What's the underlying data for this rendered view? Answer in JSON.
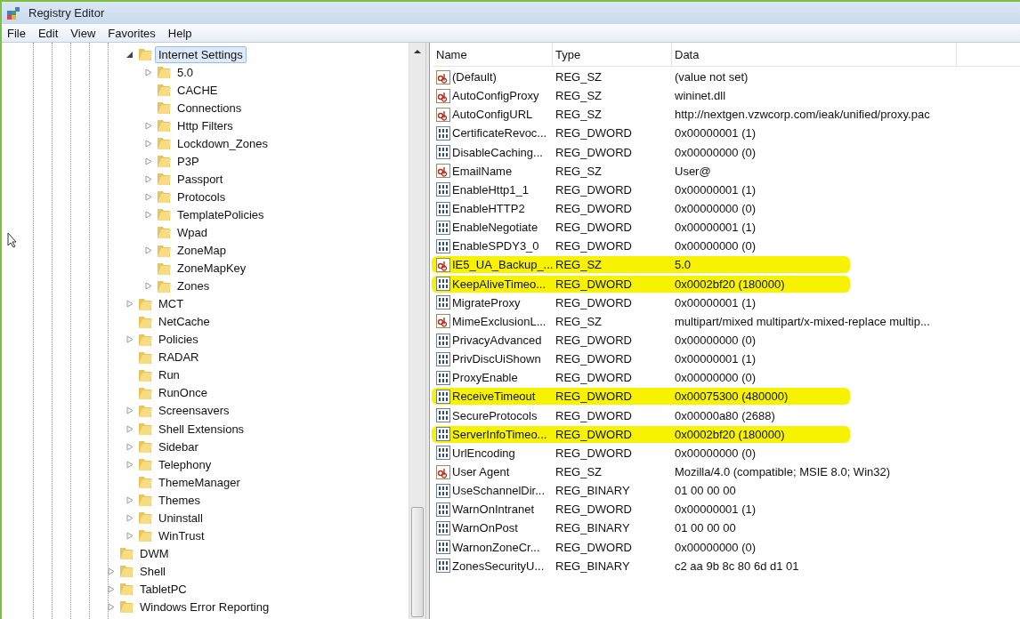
{
  "window": {
    "title": "Registry Editor"
  },
  "menu": [
    "File",
    "Edit",
    "View",
    "Favorites",
    "Help"
  ],
  "tree": {
    "inner_items": [
      {
        "label": "Internet Settings",
        "expandable": true,
        "expanded": true,
        "selected": true,
        "children": [
          {
            "label": "5.0",
            "expandable": true
          },
          {
            "label": "CACHE",
            "expandable": false
          },
          {
            "label": "Connections",
            "expandable": false
          },
          {
            "label": "Http Filters",
            "expandable": true
          },
          {
            "label": "Lockdown_Zones",
            "expandable": true
          },
          {
            "label": "P3P",
            "expandable": true
          },
          {
            "label": "Passport",
            "expandable": true
          },
          {
            "label": "Protocols",
            "expandable": true
          },
          {
            "label": "TemplatePolicies",
            "expandable": true
          },
          {
            "label": "Wpad",
            "expandable": false
          },
          {
            "label": "ZoneMap",
            "expandable": true
          },
          {
            "label": "ZoneMapKey",
            "expandable": false
          },
          {
            "label": "Zones",
            "expandable": true
          }
        ]
      },
      {
        "label": "MCT",
        "expandable": true,
        "expanded": false,
        "selected": false
      },
      {
        "label": "NetCache",
        "expandable": false,
        "selected": false
      },
      {
        "label": "Policies",
        "expandable": true,
        "expanded": false,
        "selected": false
      },
      {
        "label": "RADAR",
        "expandable": false,
        "selected": false
      },
      {
        "label": "Run",
        "expandable": false,
        "selected": false
      },
      {
        "label": "RunOnce",
        "expandable": false,
        "selected": false
      },
      {
        "label": "Screensavers",
        "expandable": true,
        "expanded": false,
        "selected": false
      },
      {
        "label": "Shell Extensions",
        "expandable": true,
        "expanded": false,
        "selected": false
      },
      {
        "label": "Sidebar",
        "expandable": true,
        "expanded": false,
        "selected": false
      },
      {
        "label": "Telephony",
        "expandable": true,
        "expanded": false,
        "selected": false
      },
      {
        "label": "ThemeManager",
        "expandable": false,
        "selected": false
      },
      {
        "label": "Themes",
        "expandable": true,
        "expanded": false,
        "selected": false
      },
      {
        "label": "Uninstall",
        "expandable": true,
        "expanded": false,
        "selected": false
      },
      {
        "label": "WinTrust",
        "expandable": true,
        "expanded": false,
        "selected": false
      }
    ],
    "outer_items": [
      {
        "label": "DWM",
        "expandable": false,
        "selected": false
      },
      {
        "label": "Shell",
        "expandable": true,
        "expanded": false,
        "selected": false
      },
      {
        "label": "TabletPC",
        "expandable": true,
        "expanded": false,
        "selected": false
      },
      {
        "label": "Windows Error Reporting",
        "expandable": true,
        "expanded": false,
        "selected": false
      }
    ]
  },
  "table": {
    "columns": [
      "Name",
      "Type",
      "Data"
    ],
    "rows": [
      {
        "kind": "string",
        "name": "(Default)",
        "type": "REG_SZ",
        "data": "(value not set)",
        "highlighted": false
      },
      {
        "kind": "string",
        "name": "AutoConfigProxy",
        "type": "REG_SZ",
        "data": "wininet.dll",
        "highlighted": false
      },
      {
        "kind": "string",
        "name": "AutoConfigURL",
        "type": "REG_SZ",
        "data": "http://nextgen.vzwcorp.com/ieak/unified/proxy.pac",
        "highlighted": false
      },
      {
        "kind": "binary",
        "name": "CertificateRevoc...",
        "type": "REG_DWORD",
        "data": "0x00000001 (1)",
        "highlighted": false
      },
      {
        "kind": "binary",
        "name": "DisableCaching...",
        "type": "REG_DWORD",
        "data": "0x00000000 (0)",
        "highlighted": false
      },
      {
        "kind": "string",
        "name": "EmailName",
        "type": "REG_SZ",
        "data": "User@",
        "highlighted": false
      },
      {
        "kind": "binary",
        "name": "EnableHttp1_1",
        "type": "REG_DWORD",
        "data": "0x00000001 (1)",
        "highlighted": false
      },
      {
        "kind": "binary",
        "name": "EnableHTTP2",
        "type": "REG_DWORD",
        "data": "0x00000000 (0)",
        "highlighted": false
      },
      {
        "kind": "binary",
        "name": "EnableNegotiate",
        "type": "REG_DWORD",
        "data": "0x00000001 (1)",
        "highlighted": false
      },
      {
        "kind": "binary",
        "name": "EnableSPDY3_0",
        "type": "REG_DWORD",
        "data": "0x00000000 (0)",
        "highlighted": false
      },
      {
        "kind": "string",
        "name": "IE5_UA_Backup_...",
        "type": "REG_SZ",
        "data": "5.0",
        "highlighted": true
      },
      {
        "kind": "binary",
        "name": "KeepAliveTimeo...",
        "type": "REG_DWORD",
        "data": "0x0002bf20 (180000)",
        "highlighted": true
      },
      {
        "kind": "binary",
        "name": "MigrateProxy",
        "type": "REG_DWORD",
        "data": "0x00000001 (1)",
        "highlighted": false
      },
      {
        "kind": "string",
        "name": "MimeExclusionL...",
        "type": "REG_SZ",
        "data": "multipart/mixed multipart/x-mixed-replace multip...",
        "highlighted": false
      },
      {
        "kind": "binary",
        "name": "PrivacyAdvanced",
        "type": "REG_DWORD",
        "data": "0x00000000 (0)",
        "highlighted": false
      },
      {
        "kind": "binary",
        "name": "PrivDiscUiShown",
        "type": "REG_DWORD",
        "data": "0x00000001 (1)",
        "highlighted": false
      },
      {
        "kind": "binary",
        "name": "ProxyEnable",
        "type": "REG_DWORD",
        "data": "0x00000000 (0)",
        "highlighted": false
      },
      {
        "kind": "binary",
        "name": "ReceiveTimeout",
        "type": "REG_DWORD",
        "data": "0x00075300 (480000)",
        "highlighted": true
      },
      {
        "kind": "binary",
        "name": "SecureProtocols",
        "type": "REG_DWORD",
        "data": "0x00000a80 (2688)",
        "highlighted": false
      },
      {
        "kind": "binary",
        "name": "ServerInfoTimeo...",
        "type": "REG_DWORD",
        "data": "0x0002bf20 (180000)",
        "highlighted": true
      },
      {
        "kind": "binary",
        "name": "UrlEncoding",
        "type": "REG_DWORD",
        "data": "0x00000000 (0)",
        "highlighted": false
      },
      {
        "kind": "string",
        "name": "User Agent",
        "type": "REG_SZ",
        "data": "Mozilla/4.0 (compatible; MSIE 8.0; Win32)",
        "highlighted": false
      },
      {
        "kind": "binary",
        "name": "UseSchannelDir...",
        "type": "REG_BINARY",
        "data": "01 00 00 00",
        "highlighted": false
      },
      {
        "kind": "binary",
        "name": "WarnOnIntranet",
        "type": "REG_DWORD",
        "data": "0x00000001 (1)",
        "highlighted": false
      },
      {
        "kind": "binary",
        "name": "WarnOnPost",
        "type": "REG_BINARY",
        "data": "01 00 00 00",
        "highlighted": false
      },
      {
        "kind": "binary",
        "name": "WarnonZoneCr...",
        "type": "REG_DWORD",
        "data": "0x00000000 (0)",
        "highlighted": false
      },
      {
        "kind": "binary",
        "name": "ZonesSecurityU...",
        "type": "REG_BINARY",
        "data": "c2 aa 9b 8c 80 6d d1 01",
        "highlighted": false
      }
    ]
  }
}
